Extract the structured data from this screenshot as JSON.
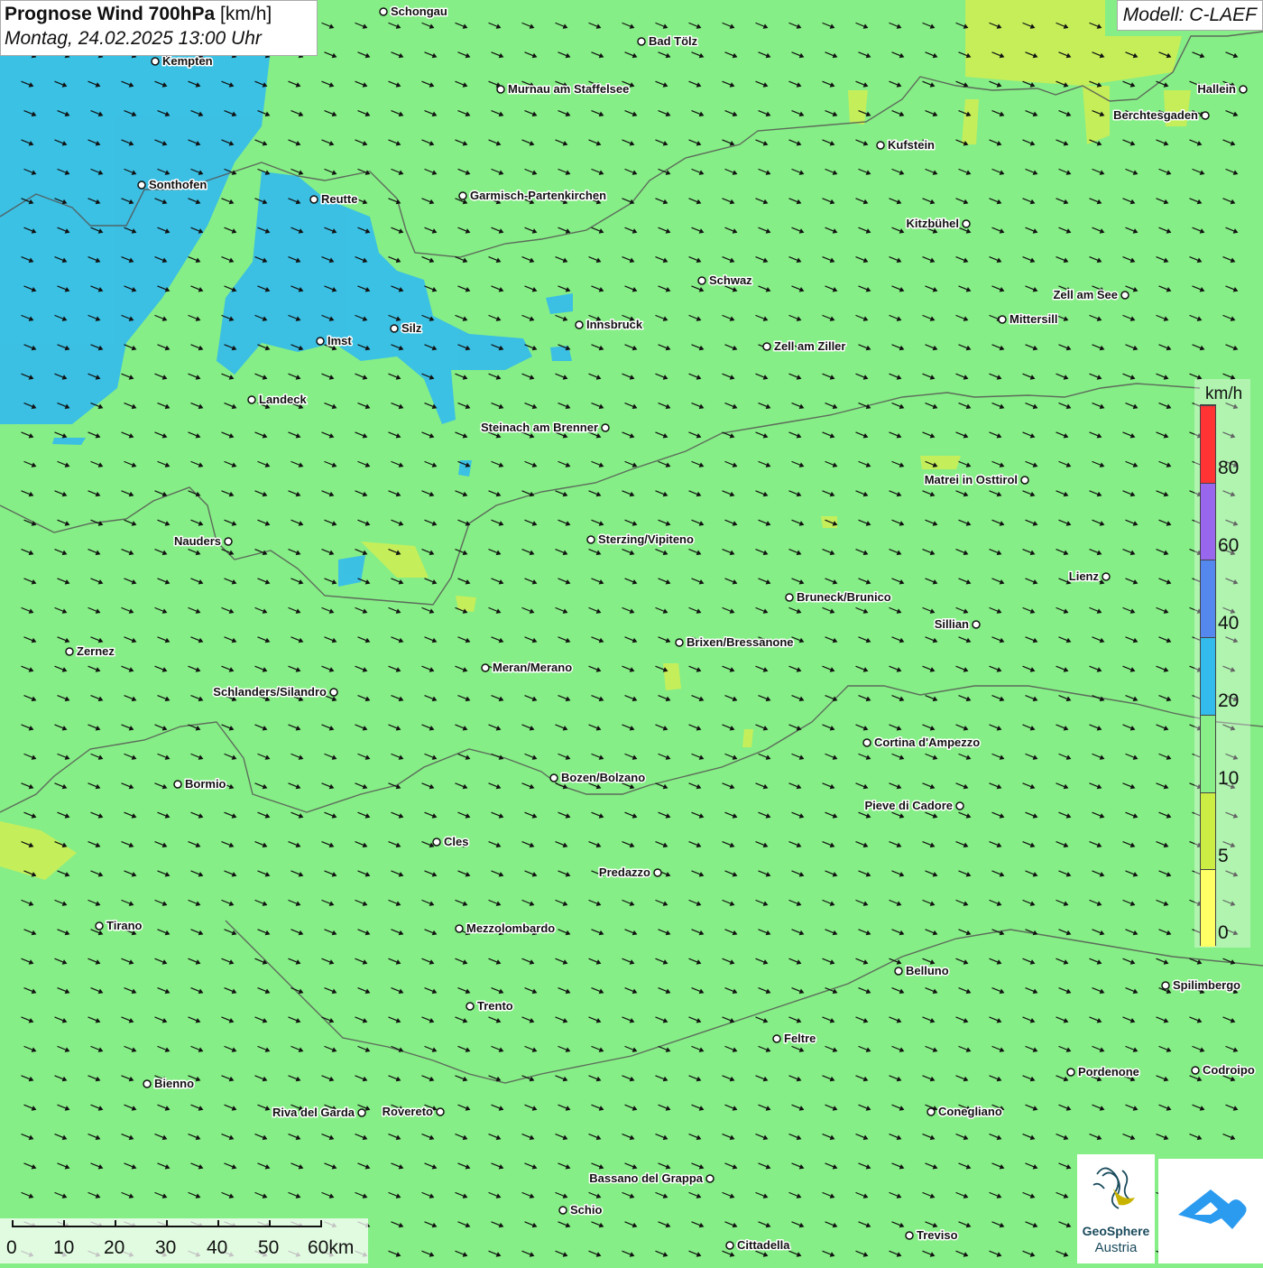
{
  "header": {
    "title_bold": "Prognose Wind 700hPa",
    "title_unit": "[km/h]",
    "subtitle": "Montag, 24.02.2025 13:00 Uhr",
    "model": "Modell: C-LAEF"
  },
  "colors": {
    "background_10_20": "#86ee86",
    "zone_20_40": "#33bbee",
    "zone_5_10": "#ccee55",
    "wind_arrow": "#111111",
    "border": "#555555"
  },
  "wind": {
    "direction": "from west-northwest",
    "arrow_icon": "wind-arrow-icon"
  },
  "legend": {
    "unit": "km/h",
    "labels": [
      "80",
      "60",
      "40",
      "20",
      "10",
      "5",
      "0"
    ],
    "segments": [
      {
        "color": "#ff3333"
      },
      {
        "color": "#9966ee"
      },
      {
        "color": "#5588ee"
      },
      {
        "color": "#33bbee"
      },
      {
        "color": "#88ee88"
      },
      {
        "color": "#ccee44"
      },
      {
        "color": "#ffff66"
      }
    ]
  },
  "cities": [
    {
      "name": "Schongau"
    },
    {
      "name": "Bad Tölz"
    },
    {
      "name": "Kempten"
    },
    {
      "name": "Murnau am Staffelsee"
    },
    {
      "name": "Hallein"
    },
    {
      "name": "Berchtesgaden"
    },
    {
      "name": "Kufstein"
    },
    {
      "name": "Sonthofen"
    },
    {
      "name": "Reutte"
    },
    {
      "name": "Garmisch-Partenkirchen"
    },
    {
      "name": "Kitzbühel"
    },
    {
      "name": "Schwaz"
    },
    {
      "name": "Zell am See"
    },
    {
      "name": "Innsbruck"
    },
    {
      "name": "Mittersill"
    },
    {
      "name": "Silz"
    },
    {
      "name": "Imst"
    },
    {
      "name": "Zell am Ziller"
    },
    {
      "name": "Landeck"
    },
    {
      "name": "Steinach am Brenner"
    },
    {
      "name": "Matrei in Osttirol"
    },
    {
      "name": "Nauders"
    },
    {
      "name": "Sterzing/Vipiteno"
    },
    {
      "name": "Lienz"
    },
    {
      "name": "Bruneck/Brunico"
    },
    {
      "name": "Sillian"
    },
    {
      "name": "Zernez"
    },
    {
      "name": "Brixen/Bressanone"
    },
    {
      "name": "Meran/Merano"
    },
    {
      "name": "Schlanders/Silandro"
    },
    {
      "name": "Cortina d'Ampezzo"
    },
    {
      "name": "Bormio"
    },
    {
      "name": "Bozen/Bolzano"
    },
    {
      "name": "Pieve di Cadore"
    },
    {
      "name": "Cles"
    },
    {
      "name": "Predazzo"
    },
    {
      "name": "Tirano"
    },
    {
      "name": "Mezzolombardo"
    },
    {
      "name": "Belluno"
    },
    {
      "name": "Spilimbergo"
    },
    {
      "name": "Trento"
    },
    {
      "name": "Feltre"
    },
    {
      "name": "Pordenone"
    },
    {
      "name": "Codroipo"
    },
    {
      "name": "Bienno"
    },
    {
      "name": "Riva del Garda"
    },
    {
      "name": "Rovereto"
    },
    {
      "name": "Conegliano"
    },
    {
      "name": "Bassano del Grappa"
    },
    {
      "name": "Schio"
    },
    {
      "name": "Treviso"
    },
    {
      "name": "Cittadella"
    }
  ],
  "scale": {
    "labels": [
      "0",
      "10",
      "20",
      "30",
      "40",
      "50",
      "60km"
    ]
  },
  "logos": {
    "geosphere_line1": "GeoSphere",
    "geosphere_line2": "Austria"
  }
}
